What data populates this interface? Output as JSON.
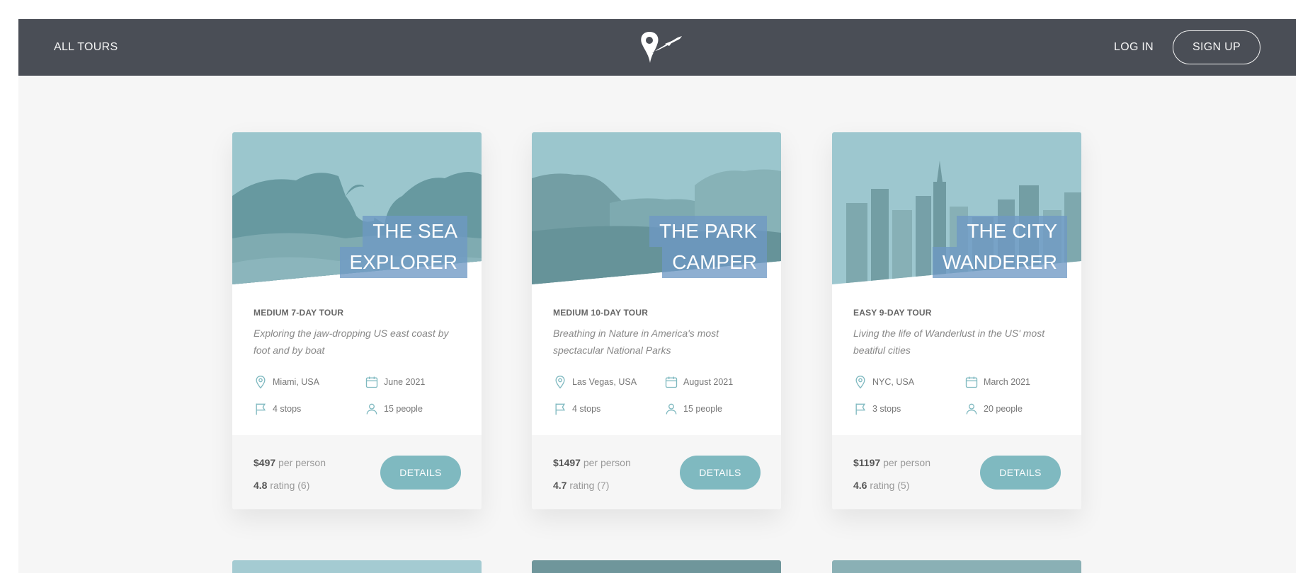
{
  "header": {
    "all_tours": "ALL TOURS",
    "log_in": "LOG IN",
    "sign_up": "SIGN UP",
    "logo_icon": "location-pin-plane-logo"
  },
  "colors": {
    "header_bg": "#4a4e56",
    "accent": "#7fb9c0",
    "title_bg": "#6e99c4",
    "page_bg": "#f6f6f6"
  },
  "tours": [
    {
      "title_line1": "THE SEA",
      "title_line2": "EXPLORER",
      "subheading": "MEDIUM 7-DAY TOUR",
      "description": "Exploring the jaw-dropping US east coast by foot and by boat",
      "location": "Miami, USA",
      "date": "June 2021",
      "stops": "4 stops",
      "people": "15 people",
      "price": "$497",
      "price_suffix": "per person",
      "rating": "4.8",
      "rating_suffix": "rating (6)",
      "button": "DETAILS"
    },
    {
      "title_line1": "THE PARK",
      "title_line2": "CAMPER",
      "subheading": "MEDIUM 10-DAY TOUR",
      "description": "Breathing in Nature in America's most spectacular National Parks",
      "location": "Las Vegas, USA",
      "date": "August 2021",
      "stops": "4 stops",
      "people": "15 people",
      "price": "$1497",
      "price_suffix": "per person",
      "rating": "4.7",
      "rating_suffix": "rating (7)",
      "button": "DETAILS"
    },
    {
      "title_line1": "THE CITY",
      "title_line2": "WANDERER",
      "subheading": "EASY 9-DAY TOUR",
      "description": "Living the life of Wanderlust in the US' most beatiful cities",
      "location": "NYC, USA",
      "date": "March 2021",
      "stops": "3 stops",
      "people": "20 people",
      "price": "$1197",
      "price_suffix": "per person",
      "rating": "4.6",
      "rating_suffix": "rating (5)",
      "button": "DETAILS"
    }
  ]
}
